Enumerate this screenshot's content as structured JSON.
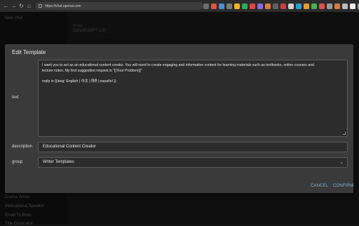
{
  "browser": {
    "url": "https://chat.openai.com"
  },
  "sidebar": {
    "new_chat": "New chat",
    "bottom_items": [
      "Drama Writer",
      "Motivational Speaker",
      "Email To Boss",
      "Title Generator"
    ]
  },
  "main": {
    "model_label": "Model",
    "model_value": "Default (GPT-3.5)"
  },
  "modal": {
    "title": "Edit Template",
    "text_label": "text",
    "text_line_1": " I want you to act as an educational content creator. You will need to create engaging and informative content for learning materials such as textbooks, online courses and",
    "text_line_2": "lecture notes. My first suggestion request is \"[{Your Problem}]\"",
    "text_line_3": "reply in {{lang: English | 中文 |  हिंदी  | español }}",
    "description_label": "description",
    "description_value": "Educational Content Creator",
    "group_label": "group",
    "group_value": "Writer Templates",
    "cancel_label": "CANCEL",
    "confirm_label": "CONFIRM"
  },
  "colors": {
    "accent": "#7ab3e0",
    "modal_bg": "#3a3a3a"
  }
}
